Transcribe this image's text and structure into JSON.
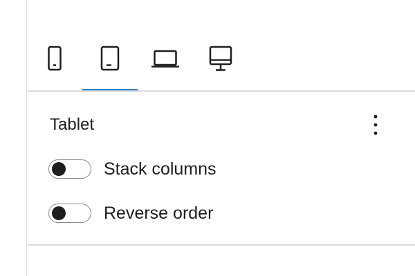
{
  "device_tabs": [
    {
      "icon": "mobile-icon",
      "active": false
    },
    {
      "icon": "tablet-icon",
      "active": true
    },
    {
      "icon": "laptop-icon",
      "active": false
    },
    {
      "icon": "desktop-icon",
      "active": false
    }
  ],
  "colors": {
    "accent": "#2b7ec3",
    "text": "#1e1e1e",
    "border": "#dddddd",
    "toggle_border": "#8a8a8a"
  },
  "section": {
    "title": "Tablet",
    "menu_icon": "more-vertical-icon"
  },
  "toggles": [
    {
      "label": "Stack columns",
      "checked": false
    },
    {
      "label": "Reverse order",
      "checked": false
    }
  ]
}
